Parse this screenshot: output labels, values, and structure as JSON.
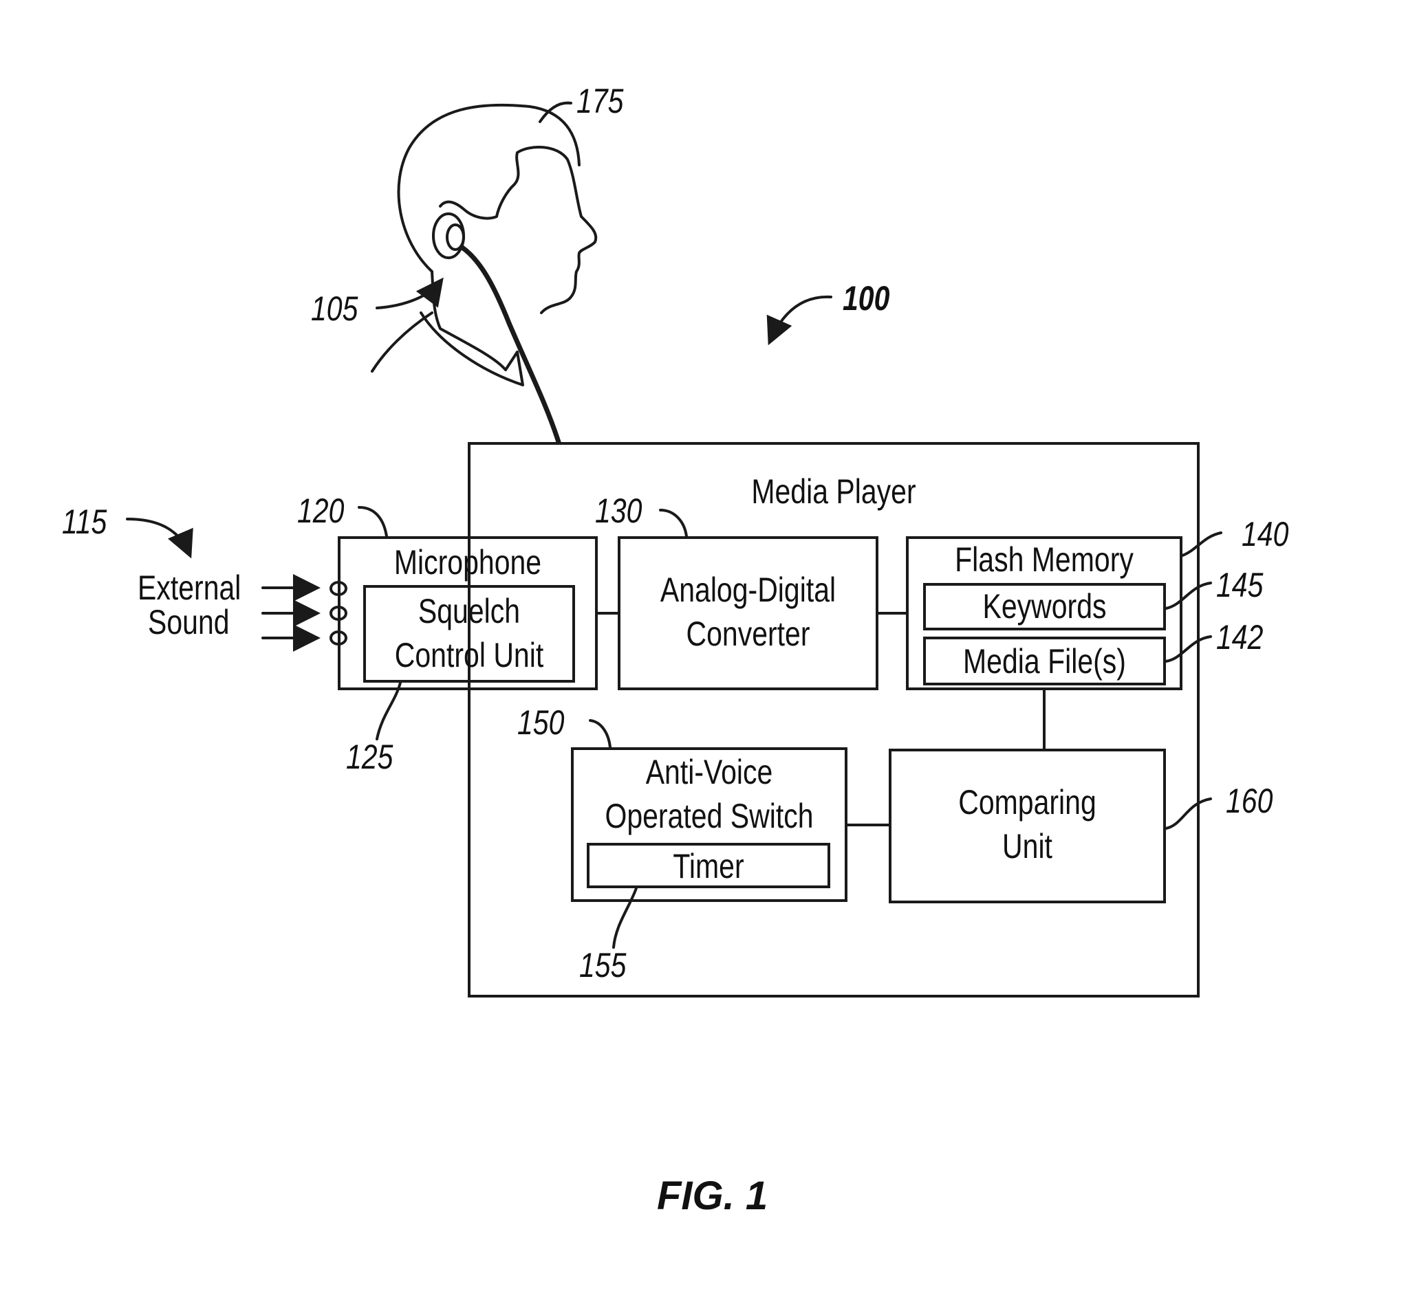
{
  "figure": {
    "label": "FIG. 1",
    "title": "Media Player"
  },
  "external_sound": {
    "line1": "External",
    "line2": "Sound"
  },
  "blocks": {
    "microphone": "Microphone",
    "squelch_line1": "Squelch",
    "squelch_line2": "Control Unit",
    "adc_line1": "Analog-Digital",
    "adc_line2": "Converter",
    "flash_memory": "Flash Memory",
    "keywords": "Keywords",
    "media_files": "Media File(s)",
    "avos_line1": "Anti-Voice",
    "avos_line2": "Operated Switch",
    "timer": "Timer",
    "comparing_line1": "Comparing",
    "comparing_line2": "Unit"
  },
  "reference_numerals": {
    "system": "100",
    "earphone": "105",
    "external_sound": "115",
    "microphone": "120",
    "squelch": "125",
    "adc": "130",
    "flash_memory": "140",
    "media_files": "142",
    "keywords": "145",
    "avos": "150",
    "timer": "155",
    "comparing_unit": "160",
    "user": "175"
  }
}
